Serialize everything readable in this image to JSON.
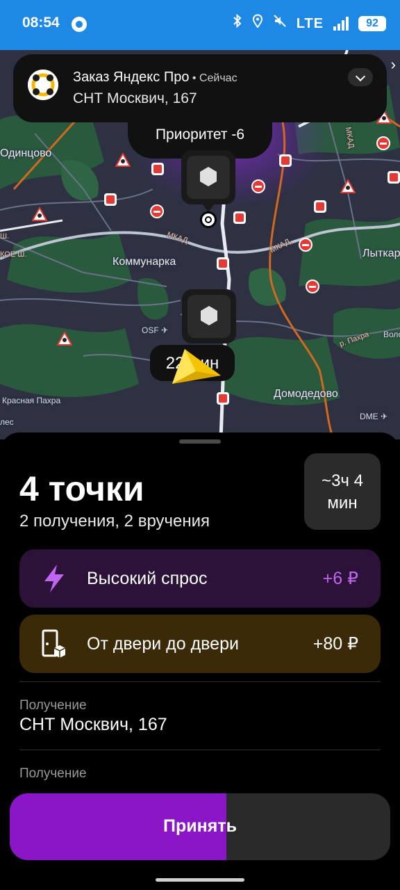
{
  "status_bar": {
    "time": "08:54",
    "network": "LTE",
    "battery": "92",
    "bluetooth_icon": "bluetooth-icon",
    "location_icon": "location-icon",
    "mute_icon": "mute-icon"
  },
  "notification": {
    "title": "Заказ Яндекс Про",
    "separator": " • ",
    "when": "Сейчас",
    "address": "СНТ Москвич, 167"
  },
  "map": {
    "priority_label": "Приоритет -6",
    "eta_label": "22 мин",
    "places": {
      "odintsovo": "Одинцово",
      "kommunarka": "Коммунарка",
      "lytkarino": "Лыткар",
      "domodedovo": "Домодедово",
      "krasnaya_pakhra": "Красная Пахра",
      "osf": "OSF",
      "dme": "DME",
      "volo": "Воло",
      "les": "лес",
      "koe_sh": "КОЕ Ш.",
      "sh": "Ш."
    },
    "roads": {
      "mkad": "МКАД",
      "pakhra": "р. Пахра"
    }
  },
  "order": {
    "title": "4 точки",
    "subtitle": "2 получения, 2 вручения",
    "duration": "~3ч 4 мин"
  },
  "bonuses": [
    {
      "label": "Высокий спрос",
      "value": "+6 ₽",
      "icon": "lightning-icon"
    },
    {
      "label": "От двери до двери",
      "value": "+80 ₽",
      "icon": "door-icon"
    }
  ],
  "points": [
    {
      "type": "Получение",
      "address": "СНТ Москвич, 167"
    },
    {
      "type": "Получение",
      "address": ""
    }
  ],
  "accept": {
    "label": "Принять",
    "progress": 0.57
  },
  "colors": {
    "status_bar": "#1e88e5",
    "accent_purple": "#8a16c8",
    "demand_bg": "#2c1238",
    "demand_value": "#c066f0",
    "door_bg": "#3a2a08"
  }
}
